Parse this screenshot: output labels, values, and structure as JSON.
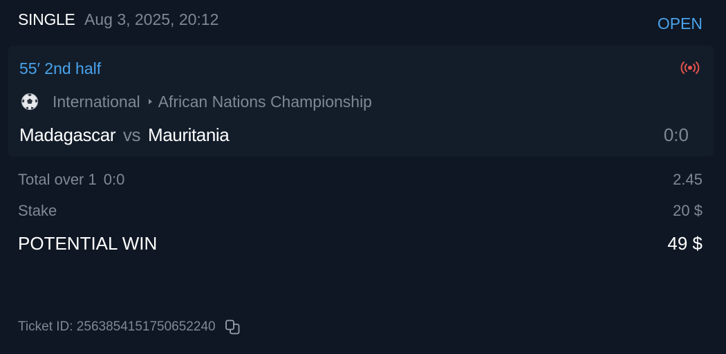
{
  "bet": {
    "type": "SINGLE",
    "date": "Aug 3, 2025, 20:12",
    "status": "OPEN"
  },
  "event": {
    "time": "55′ 2nd half",
    "sport_icon": "soccer-ball-icon",
    "live_icon": "live-broadcast-icon",
    "country": "International",
    "league": "African Nations Championship",
    "home_team": "Madagascar",
    "vs": "vs",
    "away_team": "Mauritania",
    "score": "0:0"
  },
  "selection": {
    "market": "Total over 1",
    "score_at_bet": "0:0",
    "odds": "2.45"
  },
  "stake": {
    "label": "Stake",
    "value": "20 $"
  },
  "potential_win": {
    "label": "POTENTIAL WIN",
    "value": "49 $"
  },
  "ticket": {
    "text": "Ticket ID: 2563854151750652240",
    "copy_icon": "copy-icon"
  },
  "colors": {
    "background": "#0f1724",
    "card": "#131d2a",
    "accent": "#4aa3ec",
    "live": "#e5534b",
    "muted": "#7f8896"
  }
}
